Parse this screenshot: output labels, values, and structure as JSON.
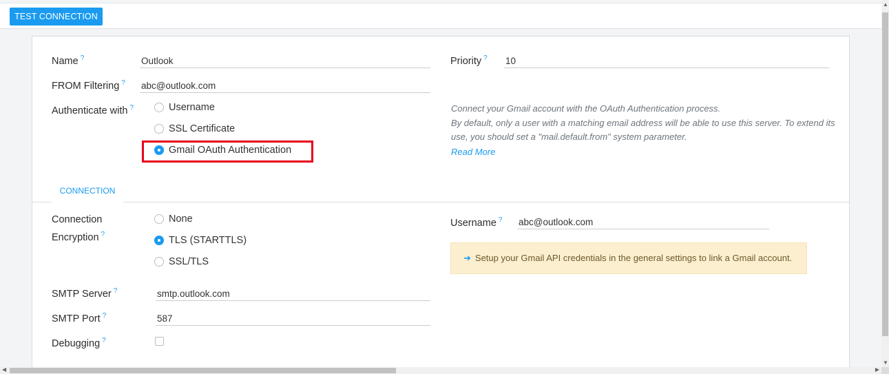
{
  "toolbar": {
    "test_connection_label": "TEST CONNECTION"
  },
  "form": {
    "name": {
      "label": "Name",
      "help": "?",
      "value": "Outlook"
    },
    "from_filtering": {
      "label": "FROM Filtering",
      "help": "?",
      "value": "abc@outlook.com"
    },
    "authenticate_with": {
      "label": "Authenticate with",
      "help": "?",
      "options": [
        "Username",
        "SSL Certificate",
        "Gmail OAuth Authentication"
      ],
      "selected": "Gmail OAuth Authentication"
    },
    "priority": {
      "label": "Priority",
      "help": "?",
      "value": "10"
    },
    "hint": {
      "line1": "Connect your Gmail account with the OAuth Authentication process.",
      "line2": "By default, only a user with a matching email address will be able to use this server. To extend its use, you should set a \"mail.default.from\" system parameter.",
      "read_more": "Read More"
    }
  },
  "tabs": {
    "connection": "CONNECTION"
  },
  "connection": {
    "encryption": {
      "label_line1": "Connection",
      "label_line2": "Encryption",
      "help": "?",
      "options": [
        "None",
        "TLS (STARTTLS)",
        "SSL/TLS"
      ],
      "selected": "TLS (STARTTLS)"
    },
    "smtp_server": {
      "label": "SMTP Server",
      "help": "?",
      "value": "smtp.outlook.com"
    },
    "smtp_port": {
      "label": "SMTP Port",
      "help": "?",
      "value": "587"
    },
    "debugging": {
      "label": "Debugging",
      "help": "?",
      "checked": false
    },
    "username": {
      "label": "Username",
      "help": "?",
      "value": "abc@outlook.com"
    },
    "alert": {
      "arrow": "➔",
      "text": "Setup your Gmail API credentials in the general settings to link a Gmail account."
    }
  },
  "scrollbars": {
    "up": "▲",
    "down": "▼",
    "left": "◀",
    "right": "▶"
  }
}
